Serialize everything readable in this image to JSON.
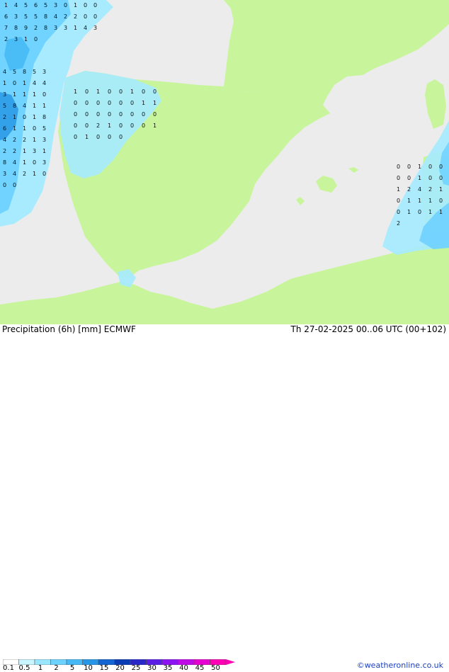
{
  "footer": {
    "title": "Precipitation (6h) [mm] ECMWF",
    "datetime": "Th 27-02-2025 00..06 UTC (00+102)",
    "credit": "©weatheronline.co.uk"
  },
  "legend": {
    "ticks": [
      "0.1",
      "0.5",
      "1",
      "2",
      "5",
      "10",
      "15",
      "20",
      "25",
      "30",
      "35",
      "40",
      "45",
      "50"
    ],
    "colors": [
      "#ffffff",
      "#c8f5ff",
      "#9be6ff",
      "#6ed2ff",
      "#46b9f5",
      "#2896e6",
      "#1464d2",
      "#0a3cb4",
      "#2828c8",
      "#5a1ee6",
      "#8c14f0",
      "#be0ae6",
      "#e600d2",
      "#ff00b4"
    ]
  },
  "colors": {
    "sea": "#ececec",
    "land": "#c8f59b",
    "light_rain": "#a5ebff",
    "moderate_rain": "#6ed2ff",
    "heavy_rain": "#2896e6"
  },
  "map_labels": {
    "atlantic_north": [
      "1",
      "4",
      "5",
      "6",
      "5",
      "3",
      "0",
      "1",
      "0",
      "0",
      "6",
      "3",
      "5",
      "5",
      "8",
      "4",
      "2",
      "2",
      "0",
      "0",
      "7",
      "8",
      "9",
      "2",
      "8",
      "3",
      "3",
      "1",
      "4",
      "3",
      "2",
      "3",
      "1",
      "0"
    ],
    "atlantic_west": [
      "4",
      "5",
      "8",
      "5",
      "3",
      "1",
      "0",
      "1",
      "4",
      "4",
      "3",
      "1",
      "1",
      "1",
      "0",
      "5",
      "8",
      "4",
      "1",
      "1",
      "2",
      "1",
      "0",
      "1",
      "8",
      "6",
      "1",
      "1",
      "0",
      "5",
      "4",
      "2",
      "2",
      "1",
      "3",
      "2",
      "2",
      "1",
      "3",
      "1",
      "8",
      "4",
      "1",
      "0",
      "3",
      "3",
      "4",
      "2",
      "1",
      "0",
      "0",
      "0"
    ],
    "iberia_northwest": [
      "1",
      "0",
      "1",
      "0",
      "0",
      "1",
      "0",
      "0",
      "0",
      "0",
      "0",
      "0",
      "0",
      "0",
      "1",
      "1",
      "0",
      "0",
      "0",
      "0",
      "0",
      "0",
      "0",
      "0",
      "0",
      "0",
      "2",
      "1",
      "0",
      "0",
      "0",
      "1",
      "0",
      "1",
      "0",
      "0",
      "0"
    ],
    "mediterranean_east": [
      "0",
      "0",
      "1",
      "0",
      "0",
      "0",
      "0",
      "1",
      "0",
      "0",
      "1",
      "2",
      "4",
      "2",
      "1",
      "0",
      "1",
      "1",
      "1",
      "0",
      "0",
      "1",
      "0",
      "1",
      "1",
      "2"
    ]
  }
}
